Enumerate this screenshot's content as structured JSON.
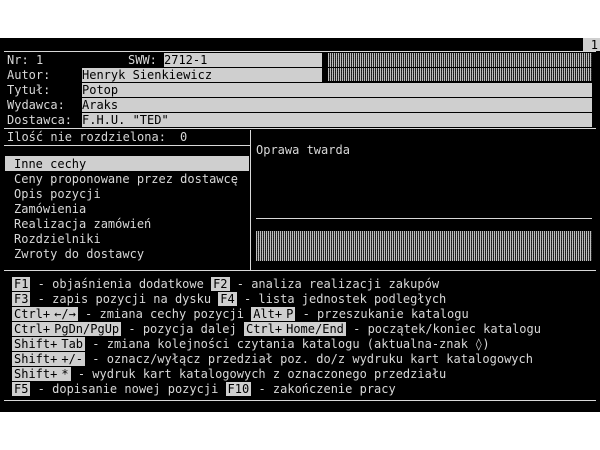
{
  "window": {
    "number": "1"
  },
  "record": {
    "nr_label": "Nr:",
    "nr_value": "1",
    "sww_label": "SWW:",
    "sww_value": "2712-1",
    "autor_label": "Autor:",
    "autor_value": "Henryk Sienkiewicz",
    "tytul_label": "Tytuł:",
    "tytul_value": "Potop",
    "wydawca_label": "Wydawca:",
    "wydawca_value": "Araks",
    "dostawca_label": "Dostawca:",
    "dostawca_value": "F.H.U. \"TED\"",
    "ilosc_label": "Ilość nie rozdzielona:",
    "ilosc_value": "0"
  },
  "menu": {
    "items": [
      "Inne cechy",
      "Ceny proponowane przez dostawcę",
      "Opis pozycji",
      "Zamówienia",
      "Realizacja zamówień",
      "Rozdzielniki",
      "Zwroty do dostawcy"
    ],
    "selected_index": 0
  },
  "detail": {
    "text": "Oprawa twarda"
  },
  "help": {
    "f1_key": "F1",
    "f1_desc": " - objaśnienia dodatkowe ",
    "f2_key": "F2",
    "f2_desc": " - analiza realizacji zakupów",
    "f3_key": "F3",
    "f3_desc": " - zapis pozycji na dysku ",
    "f4_key": "F4",
    "f4_desc": " - lista jednostek podległych",
    "ctrl1_key": "Ctrl+",
    "arrows_key": "←/→",
    "arrows_desc": " - zmiana cechy pozycji ",
    "altp_key1": "Alt+",
    "altp_key2": "P",
    "altp_desc": " - przeszukanie katalogu",
    "ctrl2_key": "Ctrl+",
    "pgdn_key": "PgDn/PgUp",
    "pgdn_desc": " - pozycja dalej ",
    "ctrl3_key": "Ctrl+",
    "home_key": "Home/End",
    "home_desc": " - początek/koniec katalogu",
    "shift1_key": "Shift+",
    "tab_key": "Tab",
    "tab_desc": " - zmiana kolejności czytania katalogu (aktualna-znak ◊)",
    "shift2_key": "Shift+",
    "pm_key": "+/-",
    "pm_desc": " - oznacz/wyłącz przedział poz. do/z wydruku kart katalogowych",
    "shift3_key": "Shift+",
    "star_key": "*",
    "star_desc": " - wydruk kart katalogowych z oznaczonego przedziału",
    "f5_key": "F5",
    "f5_desc": " - dopisanie nowej pozycji ",
    "f10_key": "F10",
    "f10_desc": " - zakończenie pracy"
  }
}
